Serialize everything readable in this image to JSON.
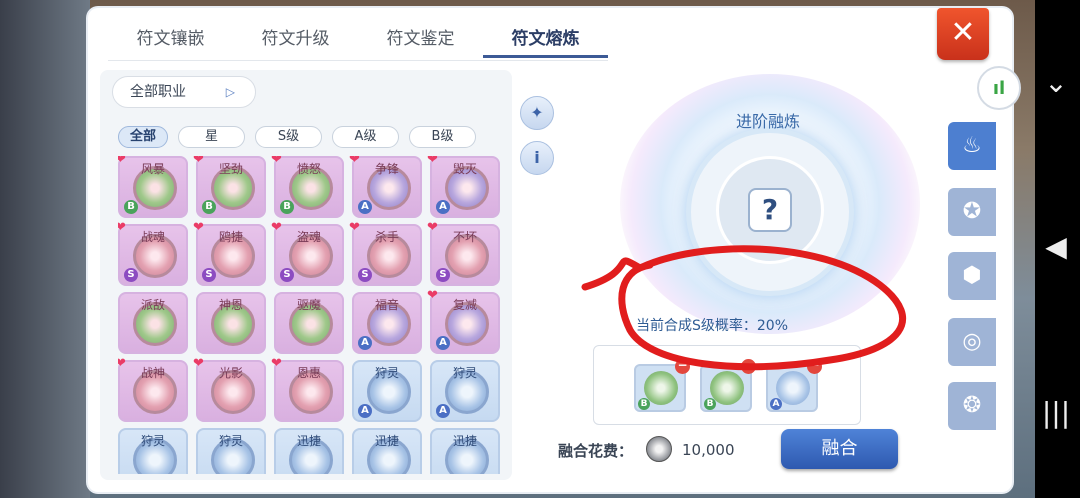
{
  "tabs": [
    "符文镶嵌",
    "符文升级",
    "符文鉴定",
    "符文熔炼"
  ],
  "active_tab": 3,
  "close_label": "✕",
  "job_filter": {
    "label": "全部职业",
    "arrow": "▷"
  },
  "grade_filters": [
    "全部",
    "星",
    "S级",
    "A级",
    "B级"
  ],
  "rune_cards": [
    {
      "name": "风暴",
      "grade": "B",
      "color": "green",
      "heart": true
    },
    {
      "name": "坚劲",
      "grade": "B",
      "color": "green",
      "heart": true
    },
    {
      "name": "愤怒",
      "grade": "B",
      "color": "green",
      "heart": true
    },
    {
      "name": "争锋",
      "grade": "A",
      "color": "purple",
      "heart": true
    },
    {
      "name": "毁灭",
      "grade": "A",
      "color": "purple",
      "heart": true
    },
    {
      "name": "战魂",
      "grade": "S",
      "color": "pink",
      "heart": true
    },
    {
      "name": "鸥捷",
      "grade": "S",
      "color": "pink",
      "heart": true
    },
    {
      "name": "盗魂",
      "grade": "S",
      "color": "pink",
      "heart": true
    },
    {
      "name": "杀手",
      "grade": "S",
      "color": "pink",
      "heart": true
    },
    {
      "name": "不坏",
      "grade": "S",
      "color": "pink",
      "heart": true
    },
    {
      "name": "派敌",
      "grade": "",
      "color": "green",
      "heart": false
    },
    {
      "name": "神恩",
      "grade": "",
      "color": "green",
      "heart": false
    },
    {
      "name": "驱魔",
      "grade": "",
      "color": "green",
      "heart": false
    },
    {
      "name": "福音",
      "grade": "A",
      "color": "purple",
      "heart": false
    },
    {
      "name": "复减",
      "grade": "A",
      "color": "purple",
      "heart": true
    },
    {
      "name": "战神",
      "grade": "",
      "color": "pink",
      "heart": true
    },
    {
      "name": "光影",
      "grade": "",
      "color": "pink",
      "heart": true
    },
    {
      "name": "恩惠",
      "grade": "",
      "color": "pink",
      "heart": true
    },
    {
      "name": "狩灵",
      "grade": "A",
      "color": "blue",
      "heart": false
    },
    {
      "name": "狩灵",
      "grade": "A",
      "color": "blue",
      "heart": false
    },
    {
      "name": "狩灵",
      "grade": "",
      "color": "blue",
      "heart": false
    },
    {
      "name": "狩灵",
      "grade": "",
      "color": "blue",
      "heart": false
    },
    {
      "name": "迅捷",
      "grade": "",
      "color": "blue",
      "heart": false
    },
    {
      "name": "迅捷",
      "grade": "",
      "color": "blue",
      "heart": false
    },
    {
      "name": "迅捷",
      "grade": "",
      "color": "blue",
      "heart": false
    }
  ],
  "fusion": {
    "title": "进阶融炼",
    "question_mark": "?",
    "rate_text": "当前合成S级概率：20%"
  },
  "materials": [
    {
      "grade": "B",
      "color": "green"
    },
    {
      "grade": "B",
      "color": "green"
    },
    {
      "grade": "A",
      "color": "blue"
    }
  ],
  "cost": {
    "label": "融合花费：",
    "value": "10,000"
  },
  "fuse_button": "融合",
  "colors": {
    "accent_blue": "#2e59b0",
    "close_red": "#e0452a",
    "annotation_red": "#e11d1d"
  }
}
